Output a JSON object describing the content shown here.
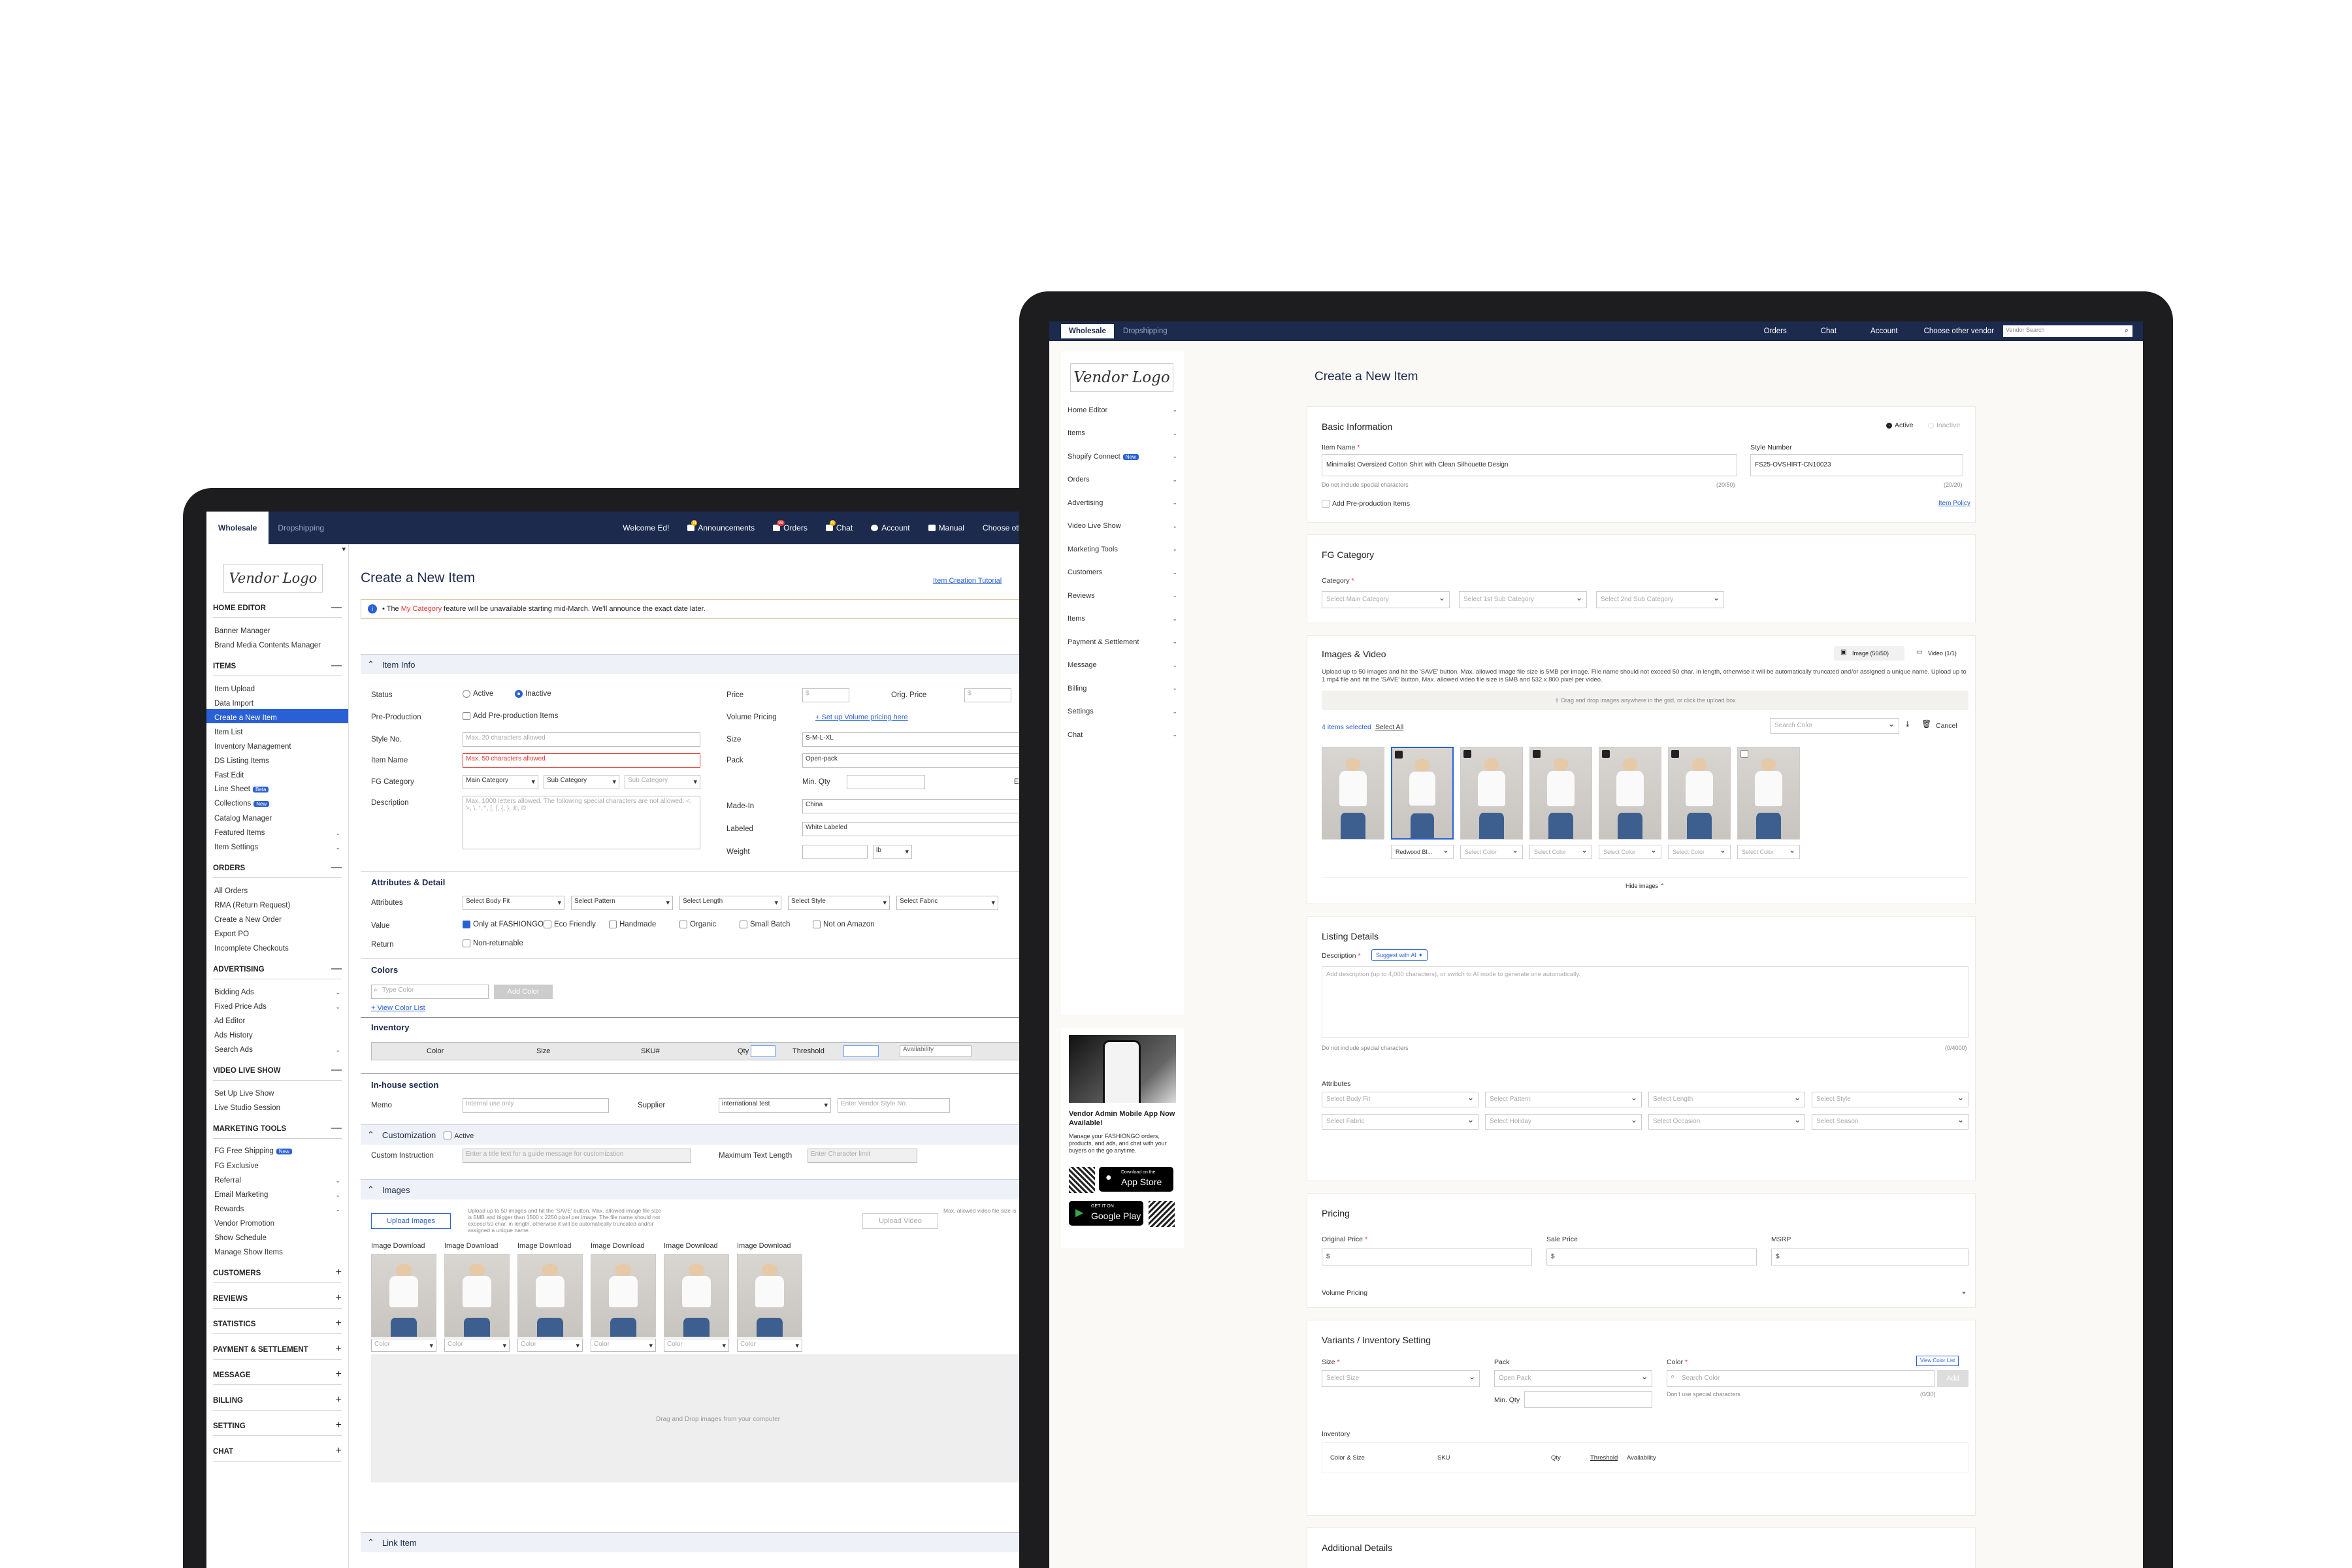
{
  "old": {
    "nav": {
      "wholesale": "Wholesale",
      "dropshipping": "Dropshipping",
      "welcome": "Welcome Ed!",
      "announcements": "Announcements",
      "orders": "Orders",
      "chat": "Chat",
      "account": "Account",
      "manual": "Manual",
      "choose_vendor": "Choose other vendor"
    },
    "logo": "Vendor Logo",
    "sidebar": [
      {
        "head": "HOME EDITOR",
        "mark": "—",
        "items": [
          "Banner Manager",
          "Brand Media Contents Manager"
        ]
      },
      {
        "head": "ITEMS",
        "mark": "—",
        "items": [
          "Item Upload",
          "Data Import",
          "Create a New Item",
          "Item List",
          "Inventory Management",
          "DS Listing Items",
          "Fast Edit",
          "Line Sheet",
          "Collections",
          "Catalog Manager",
          "Featured Items",
          "Item Settings"
        ]
      },
      {
        "head": "ORDERS",
        "mark": "—",
        "items": [
          "All Orders",
          "RMA (Return Request)",
          "Create a New Order",
          "Export PO",
          "Incomplete Checkouts"
        ]
      },
      {
        "head": "ADVERTISING",
        "mark": "—",
        "items": [
          "Bidding Ads",
          "Fixed Price Ads",
          "Ad Editor",
          "Ads History",
          "Search Ads"
        ]
      },
      {
        "head": "VIDEO LIVE SHOW",
        "mark": "—",
        "items": [
          "Set Up Live Show",
          "Live Studio Session"
        ]
      },
      {
        "head": "MARKETING TOOLS",
        "mark": "—",
        "items": [
          "FG Free Shipping",
          "FG Exclusive",
          "Referral",
          "Email Marketing",
          "Rewards",
          "Vendor Promotion",
          "Show Schedule",
          "Manage Show Items"
        ]
      },
      {
        "head": "CUSTOMERS",
        "mark": "+",
        "items": []
      },
      {
        "head": "REVIEWS",
        "mark": "+",
        "items": []
      },
      {
        "head": "STATISTICS",
        "mark": "+",
        "items": []
      },
      {
        "head": "PAYMENT & SETTLEMENT",
        "mark": "+",
        "items": []
      },
      {
        "head": "MESSAGE",
        "mark": "+",
        "items": []
      },
      {
        "head": "BILLING",
        "mark": "+",
        "items": []
      },
      {
        "head": "SETTING",
        "mark": "+",
        "items": []
      },
      {
        "head": "CHAT",
        "mark": "+",
        "items": []
      }
    ],
    "new_badge": "Beta",
    "new_badge2": "New",
    "title": "Create a New Item",
    "tutorial": "Item Creation Tutorial",
    "notice_pre": "The ",
    "notice_hl": "My Category",
    "notice_post": " feature will be unavailable starting mid-March. We'll announce the exact date later.",
    "sec_item_info": "Item Info",
    "status": "Status",
    "active": "Active",
    "inactive": "Inactive",
    "preprod": "Pre-Production",
    "preprod_cb": "Add Pre-production Items",
    "style_no": "Style No.",
    "style_ph": "Max. 20 characters allowed",
    "item_name": "Item Name",
    "item_ph": "Max. 50 characters allowed",
    "fg_cat": "FG Category",
    "main_cat": "Main Category",
    "sub_cat": "Sub Category",
    "sub_cat2": "Sub Category",
    "desc": "Description",
    "desc_ph": "Max. 1000 letters allowed. The following special characters are not allowed: <, >, \\, ‘, ‘‘, [, ], {, }, ®, ©",
    "price": "Price",
    "price_v": "$",
    "orig_price": "Orig. Price",
    "orig_v": "$",
    "vol_pricing": "Volume Pricing",
    "vol_link": "+ Set up Volume pricing here",
    "size": "Size",
    "size_v": "S-M-L-XL",
    "pack": "Pack",
    "pack_v": "Open-pack",
    "min_qty": "Min. Qty",
    "even_color": "Even Color",
    "made_in": "Made-In",
    "made_v": "China",
    "labeled": "Labeled",
    "labeled_v": "White Labeled",
    "weight": "Weight",
    "weight_u": "lb",
    "attr_head": "Attributes & Detail",
    "attributes": "Attributes",
    "attr_sel": [
      "Select Body Fit",
      "Select Pattern",
      "Select Length",
      "Select Style",
      "Select Fabric"
    ],
    "value": "Value",
    "values": [
      "Only at FASHIONGO",
      "Eco Friendly",
      "Handmade",
      "Organic",
      "Small Batch",
      "Not on Amazon"
    ],
    "return": "Return",
    "nonret": "Non-returnable",
    "colors": "Colors",
    "type_color": "Type Color",
    "add_color": "Add Color",
    "view_color": "+ View Color List",
    "inventory": "Inventory",
    "inv_cols": [
      "Color",
      "Size",
      "SKU#",
      "Qty",
      "Threshold",
      "Availability"
    ],
    "inhouse": "In-house section",
    "memo": "Memo",
    "memo_ph": "Internal use only",
    "supplier": "Supplier",
    "supplier_v": "international test",
    "vendor_style_ph": "Enter Vendor Style No.",
    "custom": "Customization",
    "custom_active": "Active",
    "custom_instr": "Custom Instruction",
    "custom_ph": "Enter a title text for a guide message for customization",
    "max_len": "Maximum Text Length",
    "max_len_ph": "Enter Character limit",
    "images": "Images",
    "upload_images": "Upload Images",
    "upload_note": "Upload up to 50 images and hit the 'SAVE' button. Max. allowed image file size is 5MB and bigger than 1500 x 2250 pixel per image. The file name should not exceed 50 char. in length, otherwise it will be automatically truncated and/or assigned a unique name.",
    "upload_video": "Upload Video",
    "video_note": "Max. allowed video file size is",
    "img_dl": "Image Download",
    "color_sel": "Color",
    "drag": "Drag and Drop images from your computer",
    "link_item": "Link Item"
  },
  "new": {
    "nav": {
      "wholesale": "Wholesale",
      "dropshipping": "Dropshipping",
      "orders": "Orders",
      "chat": "Chat",
      "account": "Account",
      "choose_vendor": "Choose other vendor",
      "search_ph": "Vendor Search"
    },
    "logo": "Vendor Logo",
    "sidebar": [
      "Home Editor",
      "Items",
      "Shopify Connect",
      "Orders",
      "Advertising",
      "Video Live Show",
      "Marketing Tools",
      "Customers",
      "Reviews",
      "Items",
      "Payment & Settlement",
      "Message",
      "Billing",
      "Settings",
      "Chat"
    ],
    "new_badge": "New",
    "promo_title": "Vendor Admin Mobile App Now Available!",
    "promo_body": "Manage your FASHIONGO orders, products, and ads, and chat with your buyers on the go anytime.",
    "appstore_small": "Download on the",
    "appstore": "App Store",
    "gplay_small": "GET IT ON",
    "gplay": "Google Play",
    "title": "Create a New Item",
    "basic": "Basic Information",
    "active": "Active",
    "inactive": "Inactive",
    "item_name": "Item Name",
    "item_name_v": "Minimalist Oversized Cotton Shirt with Clean Silhouette Design",
    "no_special": "Do not include special characters",
    "cnt1": "(20/50)",
    "style_num": "Style Number",
    "style_v": "FS25-OVSHIRT-CN10023",
    "cnt2": "(20/20)",
    "preprod": "Add Pre-production Items",
    "policy": "Item Policy",
    "fg_cat": "FG Category",
    "category": "Category",
    "cat_sel": [
      "Select Main Category",
      "Select 1st Sub Category",
      "Select 2nd Sub Category"
    ],
    "img_vid": "Images & Video",
    "img_cnt": "Image (50/50)",
    "vid_cnt": "Video (1/1)",
    "img_note": "Upload up to 50 images and hit the 'SAVE' button. Max. allowed image file size is 5MB per image. File name should not exceed 50 char. in length, otherwise it will be automatically truncated and/or assigned a unique name. Upload up to 1 mp4 file and hit the 'SAVE' button. Max. allowed video file size is 5MB and 532 x 800 pixel per video.",
    "drop_hint": "Drag and drop images anywhere in the grid, or click the upload box",
    "sel_count": "4 items selected",
    "sel_all": "Select All",
    "search_color": "Search Color",
    "cancel": "Cancel",
    "thumb_colors": [
      "Redwood Bl...",
      "Select Color",
      "Select Color",
      "Select Color",
      "Select Color",
      "Select Color"
    ],
    "hide_images": "Hide images",
    "listing": "Listing Details",
    "description": "Description",
    "suggest_ai": "Suggest with AI",
    "desc_ph": "Add description (up to 4,000 characters), or switch to AI mode to generate one automatically.",
    "no_special2": "Do not include special characters",
    "cnt3": "(0/4000)",
    "attributes": "Attributes",
    "attr_sel": [
      "Select Body Fit",
      "Select Pattern",
      "Select Length",
      "Select Style",
      "Select Fabric",
      "Select Holiday",
      "Select Occasion",
      "Select Season"
    ],
    "pricing": "Pricing",
    "orig_price": "Original Price",
    "sale_price": "Sale Price",
    "msrp": "MSRP",
    "dollar": "$",
    "vol_pricing": "Volume Pricing",
    "variants": "Variants / Inventory Setting",
    "size": "Size",
    "size_ph": "Select Size",
    "pack": "Pack",
    "pack_ph": "Open Pack",
    "min_qty": "Min. Qty",
    "color": "Color",
    "view_color": "View Color List",
    "search_color2": "Search Color",
    "add": "Add",
    "no_special3": "Don't use special characters",
    "cnt4": "(0/30)",
    "inventory": "Inventory",
    "inv_cols": [
      "Color & Size",
      "SKU",
      "Qty",
      "Threshold",
      "Availability"
    ],
    "additional": "Additional Details"
  }
}
